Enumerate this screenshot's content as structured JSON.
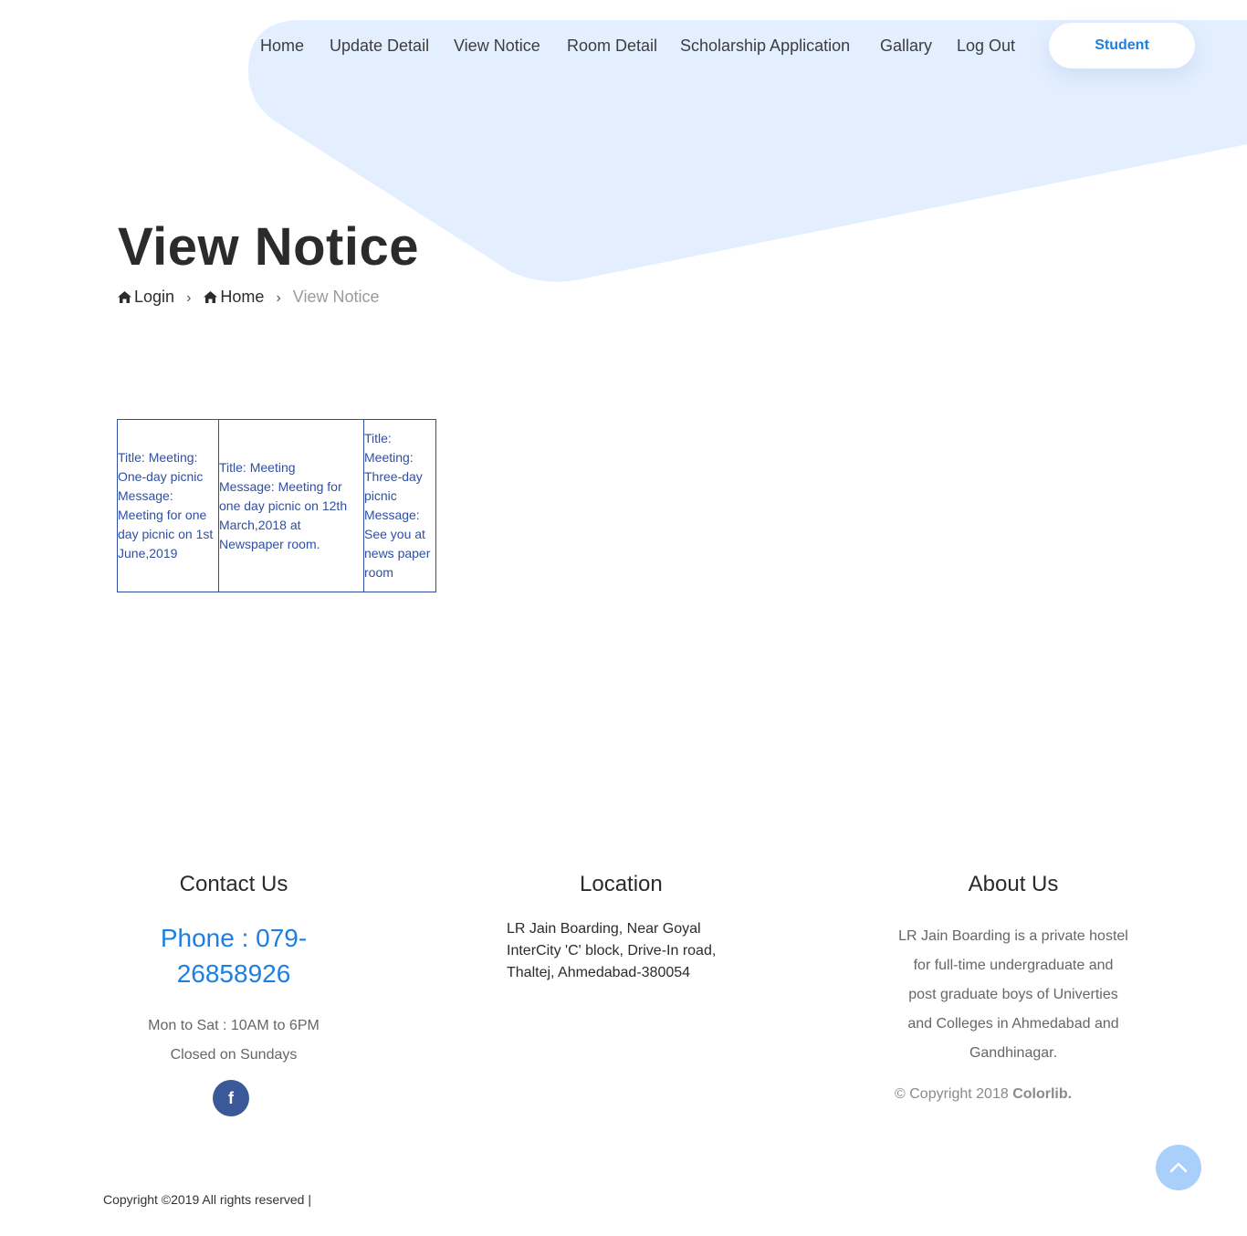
{
  "nav": {
    "items": [
      "Home",
      "Update Detail",
      "View Notice",
      "Room Detail",
      "Scholarship Application",
      "Gallary",
      "Log Out"
    ],
    "cta_label": "Student"
  },
  "page": {
    "title": "View Notice",
    "breadcrumb": {
      "login": "Login",
      "home": "Home",
      "current": "View Notice"
    }
  },
  "notices": [
    {
      "lines": [
        "Title: Meeting:",
        "One-day picnic",
        "Message:",
        "Meeting for one",
        "day picnic on 1st",
        "June,2019"
      ]
    },
    {
      "lines": [
        "Title: Meeting",
        "Message: Meeting for",
        "one day picnic on 12th",
        "March,2018 at",
        "Newspaper room."
      ]
    },
    {
      "lines": [
        "Title:",
        "Meeting:",
        "Three-day",
        "picnic",
        "Message:",
        "See you at",
        "news paper",
        "room"
      ]
    }
  ],
  "footer": {
    "contact": {
      "heading": "Contact Us",
      "phone_line1": "Phone : 079-",
      "phone_line2": "26858926",
      "hours": "Mon to Sat : 10AM to 6PM",
      "closed": "Closed on Sundays",
      "social_icon": "facebook-icon"
    },
    "location": {
      "heading": "Location",
      "address_lines": [
        "LR Jain Boarding, Near Goyal",
        "InterCity 'C' block, Drive-In road,",
        "Thaltej, Ahmedabad-380054"
      ]
    },
    "about": {
      "heading": "About Us",
      "text_lines": [
        "LR Jain Boarding is a private hostel",
        "for full-time undergraduate and",
        "post graduate boys of Univerties",
        "and Colleges in Ahmedabad and",
        "Gandhinagar."
      ],
      "copyright_prefix": "© Copyright 2018 ",
      "copyright_brand": "Colorlib."
    },
    "bottom_copyright": "Copyright ©2019 All rights reserved |"
  },
  "colors": {
    "accent": "#1d7fe0",
    "hero_shape": "#e3efff",
    "notice_border": "#2f4fa3",
    "facebook": "#3b5998",
    "scroll_top": "#a9d0fa"
  }
}
